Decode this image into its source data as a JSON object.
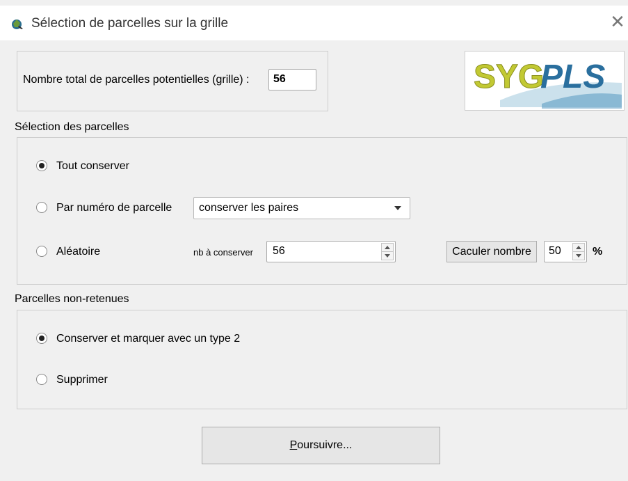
{
  "window": {
    "title": "Sélection de parcelles sur la grille",
    "close_icon": "close-icon"
  },
  "colors": {
    "logo_green": "#c2c933",
    "logo_blue": "#2a6f9e",
    "window_bg": "#f0f0f0"
  },
  "total": {
    "label": "Nombre total de parcelles potentielles (grille) :",
    "value": "56"
  },
  "logo": {
    "text_part1": "SYG",
    "text_part2": "PLS"
  },
  "selection": {
    "section_label": "Sélection des parcelles",
    "options": {
      "keep_all": "Tout conserver",
      "by_number": "Par numéro de parcelle",
      "random": "Aléatoire"
    },
    "selected": "keep_all",
    "combo_value": "conserver les paires",
    "nb_label": "nb à conserver",
    "nb_value": "56",
    "calc_button": "Caculer nombre",
    "percent_value": "50",
    "percent_symbol": "%"
  },
  "unretained": {
    "section_label": "Parcelles non-retenues",
    "options": {
      "keep_mark": "Conserver et marquer avec un type 2",
      "delete": "Supprimer"
    },
    "selected": "keep_mark"
  },
  "continue_button": {
    "mnemonic": "P",
    "rest": "oursuivre..."
  }
}
